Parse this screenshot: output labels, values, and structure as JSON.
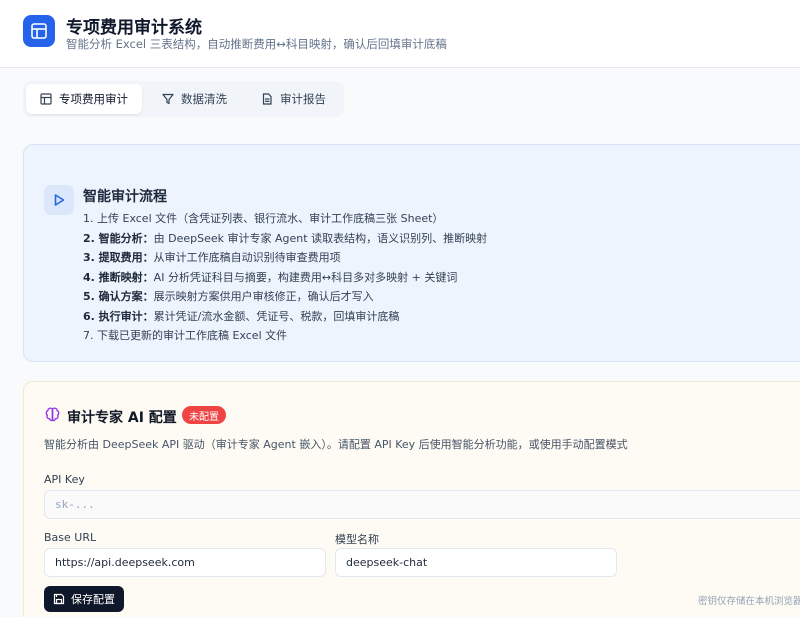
{
  "app": {
    "title": "专项费用审计系统",
    "subtitle": "智能分析 Excel 三表结构，自动推断费用↔科目映射，确认后回填审计底稿",
    "brand_color": "#2563eb"
  },
  "tabs": [
    {
      "label": "专项费用审计",
      "icon": "table-icon",
      "active": true
    },
    {
      "label": "数据清洗",
      "icon": "filter-icon",
      "active": false
    },
    {
      "label": "审计报告",
      "icon": "document-icon",
      "active": false
    }
  ],
  "flow": {
    "title": "智能审计流程",
    "steps": [
      {
        "bold": "",
        "text": "1. 上传 Excel 文件（含凭证列表、银行流水、审计工作底稿三张 Sheet）"
      },
      {
        "bold": "2. 智能分析：",
        "text": "由 DeepSeek 审计专家 Agent 读取表结构，语义识别列、推断映射"
      },
      {
        "bold": "3. 提取费用：",
        "text": "从审计工作底稿自动识别待审查费用项"
      },
      {
        "bold": "4. 推断映射：",
        "text": "AI 分析凭证科目与摘要，构建费用↔科目多对多映射 + 关键词"
      },
      {
        "bold": "5. 确认方案：",
        "text": "展示映射方案供用户审核修正，确认后才写入"
      },
      {
        "bold": "6. 执行审计：",
        "text": "累计凭证/流水金额、凭证号、税款，回填审计底稿"
      },
      {
        "bold": "",
        "text": "7. 下载已更新的审计工作底稿 Excel 文件"
      }
    ]
  },
  "ai_config": {
    "title": "审计专家 AI 配置",
    "status_badge": "未配置",
    "description": "智能分析由 DeepSeek API 驱动（审计专家 Agent 嵌入）。请配置 API Key 后使用智能分析功能，或使用手动配置模式",
    "api_key": {
      "label": "API Key",
      "placeholder": "sk-..."
    },
    "base_url": {
      "label": "Base URL",
      "value": "https://api.deepseek.com"
    },
    "model": {
      "label": "模型名称",
      "value": "deepseek-chat"
    },
    "save_label": "保存配置",
    "storage_note": "密钥仅存储在本机浏览器"
  }
}
